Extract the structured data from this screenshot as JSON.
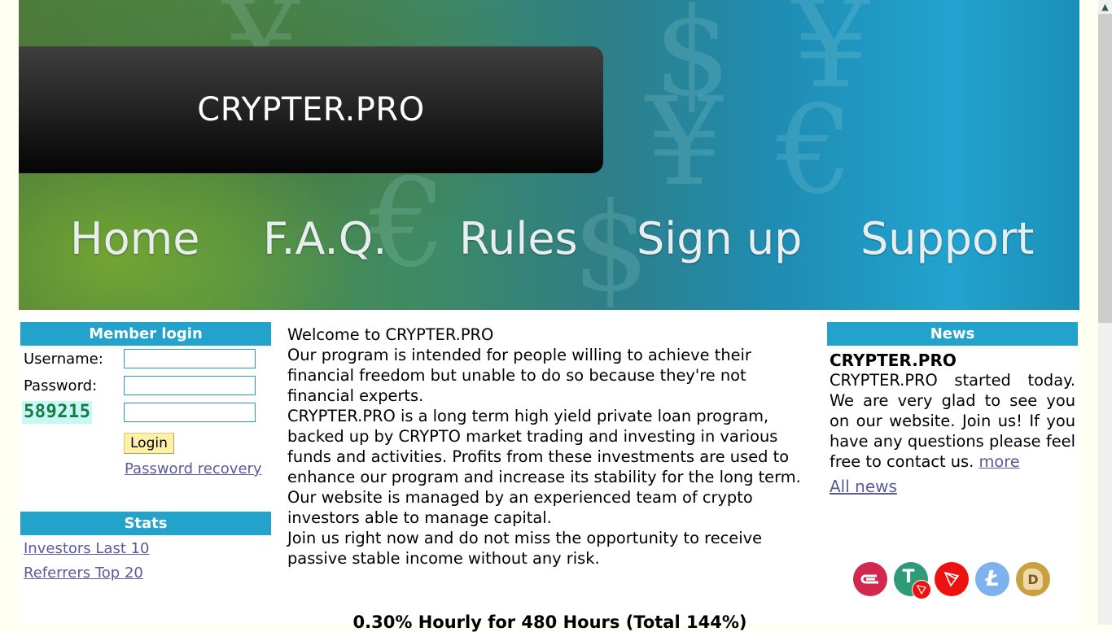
{
  "header": {
    "logo_text": "CRYPTER.PRO",
    "nav": [
      {
        "label": "Home"
      },
      {
        "label": "F.A.Q."
      },
      {
        "label": "Rules"
      },
      {
        "label": "Sign up"
      },
      {
        "label": "Support"
      }
    ]
  },
  "login": {
    "title": "Member login",
    "username_label": "Username:",
    "username_value": "",
    "password_label": "Password:",
    "password_value": "",
    "captcha_code": "589215",
    "captcha_value": "",
    "login_button": "Login",
    "recovery_link": "Password recovery"
  },
  "stats": {
    "title": "Stats",
    "links": [
      {
        "label": "Investors Last 10"
      },
      {
        "label": "Referrers Top 20"
      }
    ]
  },
  "main": {
    "paragraphs": [
      "Welcome to CRYPTER.PRO",
      "Our program is intended for people willing to achieve their financial freedom but unable to do so because they're not financial experts.",
      "CRYPTER.PRO is a long term high yield private loan program, backed up by CRYPTO market trading and investing in various funds and activities. Profits from these investments are used to enhance our program and increase its stability for the long term.",
      "Our website is managed by an experienced team of crypto investors able to manage capital.",
      "Join us right now and do not miss the opportunity to receive passive stable income without any risk."
    ],
    "plan_title": "0.30% Hourly for 480 Hours (Total 144%)"
  },
  "news": {
    "title": "News",
    "item_title": "CRYPTER.PRO",
    "item_body": "CRYPTER.PRO started today. We are very glad to see you on our website. Join us! If you have any questions please feel free to contact us.",
    "more_link": "more",
    "all_news_link": "All news"
  },
  "payment_icons": [
    {
      "name": "epaycore-icon",
      "color": "#d0284e"
    },
    {
      "name": "usdt-trc20-icon",
      "color": "#2f9a78"
    },
    {
      "name": "tron-icon",
      "color": "#ee1111"
    },
    {
      "name": "litecoin-icon",
      "color": "#7eb2ee"
    },
    {
      "name": "dogecoin-icon",
      "color": "#c8a040"
    }
  ],
  "colors": {
    "accent": "#23a2cc",
    "link": "#5a5a9a",
    "button_bg": "#fff0a8",
    "page_bg": "#fffff2"
  }
}
